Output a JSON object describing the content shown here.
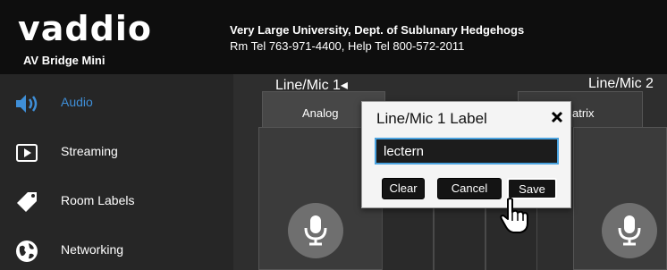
{
  "header": {
    "logo_text": "vaddio",
    "product_name": "AV Bridge Mini",
    "site_title": "Very Large University, Dept. of Sublunary Hedgehogs",
    "site_phones": "Rm Tel 763-971-4400, Help Tel 800-572-2011"
  },
  "sidebar": {
    "items": [
      {
        "label": "Audio",
        "icon": "speaker-icon",
        "active": true
      },
      {
        "label": "Streaming",
        "icon": "play-icon",
        "active": false
      },
      {
        "label": "Room Labels",
        "icon": "tag-icon",
        "active": false
      },
      {
        "label": "Networking",
        "icon": "globe-icon",
        "active": false
      }
    ]
  },
  "main": {
    "tabs": [
      {
        "label": "Analog"
      },
      {
        "label": "atrix"
      }
    ],
    "channels": [
      {
        "label": "Line/Mic 1◂",
        "mic_icon": "microphone-icon"
      },
      {
        "label": "Line/Mic 2",
        "mic_icon": "microphone-icon"
      }
    ]
  },
  "dialog": {
    "title": "Line/Mic 1 Label",
    "close_icon": "close-icon",
    "input_value": "lectern",
    "buttons": {
      "clear": "Clear",
      "cancel": "Cancel",
      "save": "Save"
    }
  },
  "colors": {
    "accent_blue": "#3f8fd8",
    "input_border": "#4aa3e0",
    "header_bg": "#0e0e0e",
    "sidebar_bg": "#262626"
  }
}
